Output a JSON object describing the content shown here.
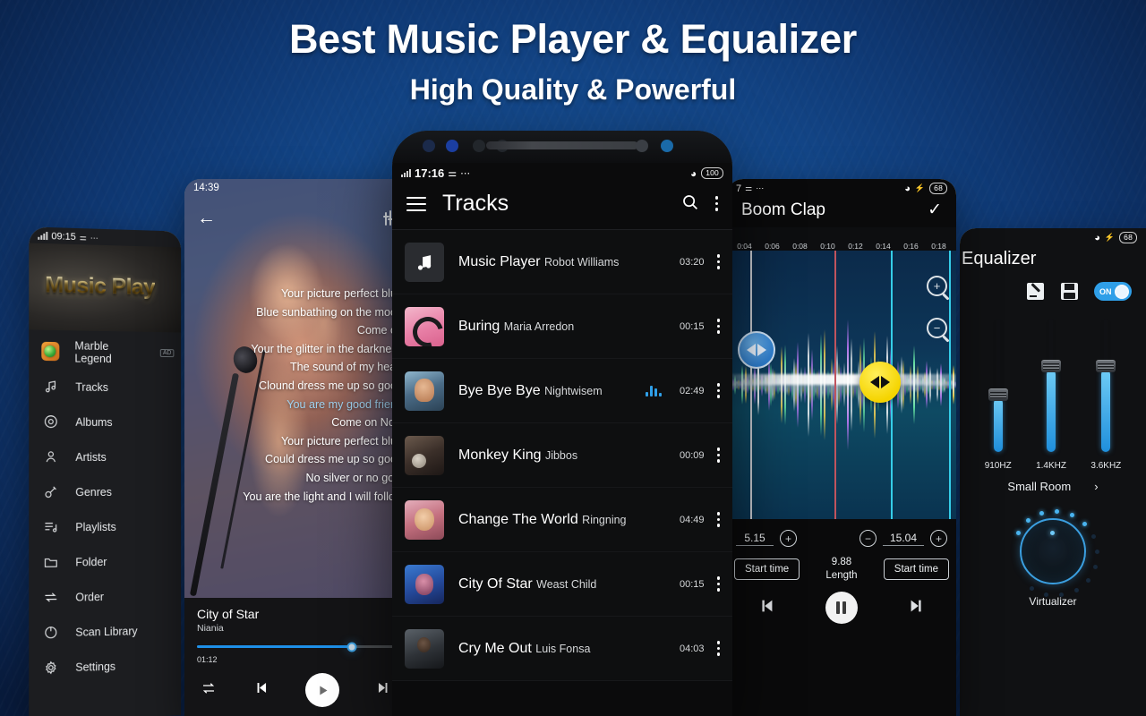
{
  "headline": {
    "line1": "Best Music Player & Equalizer",
    "line2": "High Quality & Powerful"
  },
  "colors": {
    "background_dark": "#0a2550",
    "background_light": "#1b5ba8",
    "accent_blue": "#2f9fe8",
    "accent_yellow": "#f5d400",
    "screen_dark": "#0b0b0c"
  },
  "phone_drawer": {
    "status": {
      "time": "09:15",
      "icons": "signal-usb-more"
    },
    "banner_logo": "Music Play",
    "items": [
      {
        "label": "Marble Legend",
        "icon": "game-app-icon",
        "badge": "AD"
      },
      {
        "label": "Tracks",
        "icon": "music-note-icon"
      },
      {
        "label": "Albums",
        "icon": "disc-icon"
      },
      {
        "label": "Artists",
        "icon": "person-icon"
      },
      {
        "label": "Genres",
        "icon": "guitar-icon"
      },
      {
        "label": "Playlists",
        "icon": "playlist-icon"
      },
      {
        "label": "Folder",
        "icon": "folder-icon"
      },
      {
        "label": "Order",
        "icon": "arrows-icon"
      },
      {
        "label": "Scan Library",
        "icon": "refresh-icon"
      },
      {
        "label": "Settings",
        "icon": "gear-icon"
      }
    ]
  },
  "phone_lyrics": {
    "status": {
      "time": "14:39"
    },
    "back_icon": "back-arrow-icon",
    "eq_icon": "equalizer-sliders-icon",
    "lyrics": [
      {
        "text": "Your picture perfect blue",
        "active": false
      },
      {
        "text": "Blue sunbathing on the moon",
        "active": false
      },
      {
        "text": "Come on",
        "active": false
      },
      {
        "text": "Your the glitter in the darkness",
        "active": false
      },
      {
        "text": "The sound of my heart",
        "active": false
      },
      {
        "text": "Clound dress me up so good",
        "active": false
      },
      {
        "text": "You are my good friend",
        "active": true
      },
      {
        "text": "Come on  Now",
        "active": false
      },
      {
        "text": "Your picture perfect blue",
        "active": false
      },
      {
        "text": "Could dress me up so good",
        "active": false
      },
      {
        "text": "No silver or no gold",
        "active": false
      },
      {
        "text": "You are the light and I will follow",
        "active": false
      }
    ],
    "now_playing": {
      "title": "City of Star",
      "artist": "Niania",
      "elapsed": "01:12",
      "progress_percent": 78
    },
    "controls": {
      "repeat": "repeat-icon",
      "previous": "previous-track-icon",
      "play": "play-icon",
      "next": "next-track-icon"
    }
  },
  "phone_tracks": {
    "status": {
      "time": "17:16",
      "battery": "100",
      "wifi": "wifi-icon"
    },
    "header": {
      "menu_icon": "hamburger-menu-icon",
      "title": "Tracks",
      "search_icon": "search-icon",
      "overflow_icon": "more-vertical-icon"
    },
    "tracks": [
      {
        "title": "Music Player",
        "artist": "Robot Williams",
        "duration": "03:20",
        "thumb": "th-note",
        "playing": false
      },
      {
        "title": "Buring",
        "artist": "Maria Arredon",
        "duration": "00:15",
        "thumb": "th-pink",
        "playing": false
      },
      {
        "title": "Bye Bye Bye",
        "artist": "Nightwisem",
        "duration": "02:49",
        "thumb": "th-boy",
        "playing": true
      },
      {
        "title": "Monkey King",
        "artist": "Jibbos",
        "duration": "00:09",
        "thumb": "th-dark",
        "playing": false
      },
      {
        "title": "Change The World",
        "artist": "Ringning",
        "duration": "04:49",
        "thumb": "th-baby",
        "playing": false
      },
      {
        "title": "City Of Star",
        "artist": "Weast Child",
        "duration": "00:15",
        "thumb": "th-blue",
        "playing": false
      },
      {
        "title": "Cry Me Out",
        "artist": "Luis Fonsa",
        "duration": "04:03",
        "thumb": "th-man",
        "playing": false
      }
    ]
  },
  "phone_editor": {
    "status": {
      "time": "7",
      "battery": "68"
    },
    "title": "Boom Clap",
    "confirm_icon": "check-icon",
    "ruler_ticks": [
      "0:04",
      "0:06",
      "0:08",
      "0:10",
      "0:12",
      "0:14",
      "0:16",
      "0:18"
    ],
    "zoom_in_icon": "zoom-in-icon",
    "zoom_out_icon": "zoom-out-icon",
    "left_handle_icon": "left-right-drag-handle",
    "right_handle_icon": "left-right-drag-handle",
    "start_value": "5.15",
    "end_value": "15.04",
    "length_value": "9.88",
    "length_label": "Length",
    "start_time_left_label": "Start time",
    "start_time_right_label": "Start time",
    "transport": {
      "previous": "previous-track-icon",
      "pause": "pause-icon",
      "next": "next-track-icon"
    }
  },
  "phone_equalizer": {
    "status": {
      "battery": "68"
    },
    "title": "Equalizer",
    "edit_icon": "edit-preset-icon",
    "save_icon": "save-icon",
    "toggle_label": "ON",
    "bands": [
      {
        "label": "910HZ",
        "level_percent": 40
      },
      {
        "label": "1.4KHZ",
        "level_percent": 62
      },
      {
        "label": "3.6KHZ",
        "level_percent": 62
      }
    ],
    "room_preset": "Small Room",
    "room_chevron": "chevron-right-icon",
    "knob_label": "Virtualizer"
  }
}
